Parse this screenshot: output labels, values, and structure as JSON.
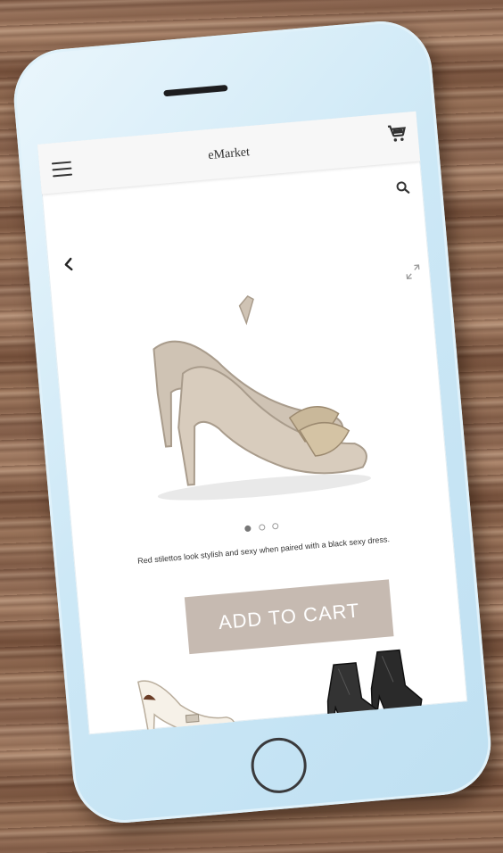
{
  "app": {
    "title": "eMarket"
  },
  "icons": {
    "menu": "hamburger-menu-icon",
    "cart": "shopping-cart-icon",
    "search": "search-icon",
    "back": "chevron-left-icon",
    "expand": "expand-icon"
  },
  "product": {
    "description": "Red stilettos look stylish and sexy when paired with a black sexy dress.",
    "carousel": {
      "total": 3,
      "active": 1
    }
  },
  "actions": {
    "add_to_cart_label": "ADD TO CART"
  },
  "colors": {
    "button_bg": "#c6bab1",
    "button_text": "#ffffff",
    "phone_body": "#cde8f6"
  }
}
